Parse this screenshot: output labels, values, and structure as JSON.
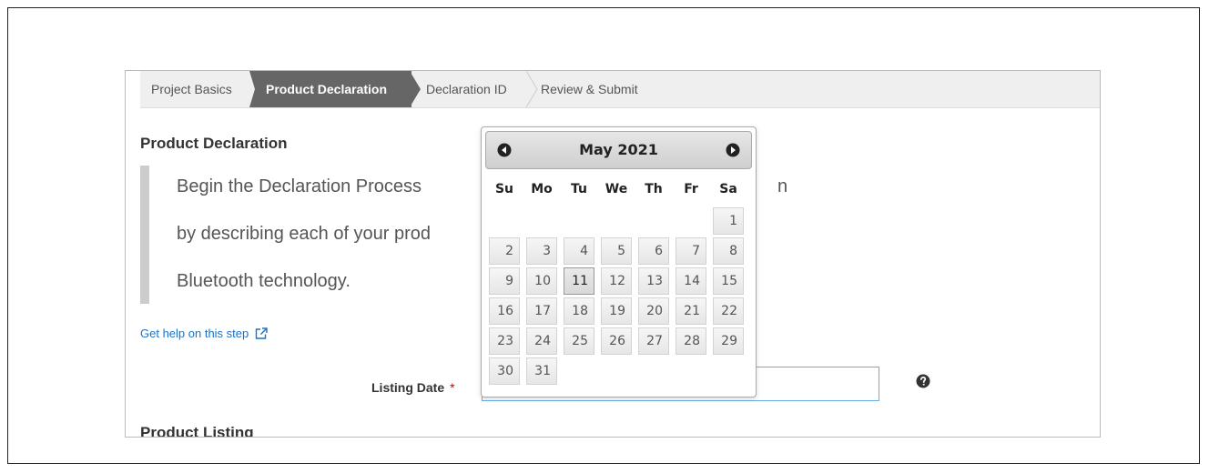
{
  "steps": [
    {
      "label": "Project Basics",
      "state": "done"
    },
    {
      "label": "Product Declaration",
      "state": "active"
    },
    {
      "label": "Declaration ID",
      "state": "pending"
    },
    {
      "label": "Review & Submit",
      "state": "pending"
    }
  ],
  "section": {
    "title": "Product Declaration",
    "intro_lines": [
      "Begin the Declaration Process",
      "by describing each of your prod",
      "Bluetooth technology."
    ],
    "intro_tail": "n"
  },
  "help": {
    "link_label": "Get help on this step",
    "icon": "external-link-icon"
  },
  "form": {
    "listing_date_label": "Listing Date",
    "required_marker": "*",
    "listing_date_value": "",
    "field_help_icon": "question-circle-icon"
  },
  "next_section_title": "Product Listing",
  "datepicker": {
    "title": "May 2021",
    "prev_icon": "circle-arrow-left-icon",
    "next_icon": "circle-arrow-right-icon",
    "weekdays": [
      "Su",
      "Mo",
      "Tu",
      "We",
      "Th",
      "Fr",
      "Sa"
    ],
    "first_weekday_index": 6,
    "days_in_month": 31,
    "today": 11
  },
  "colors": {
    "active_step": "#666666",
    "link": "#1a73c8",
    "required": "#cc0000",
    "input_focus_border": "#66afe9"
  }
}
